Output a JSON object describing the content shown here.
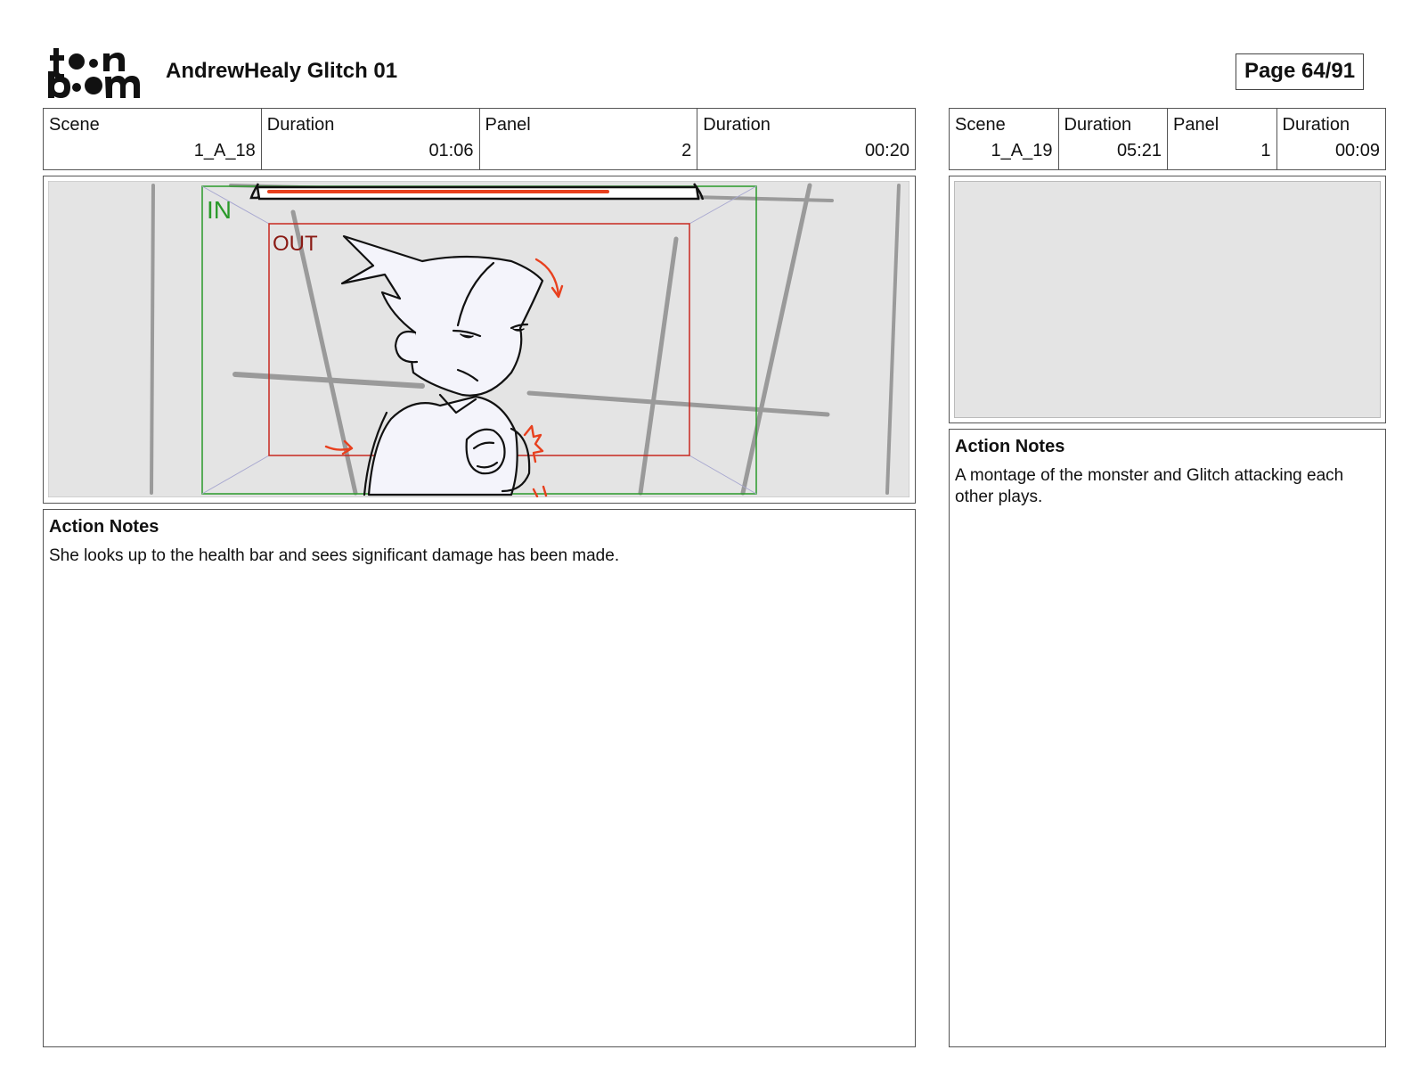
{
  "logo": {
    "word_top": "toon",
    "word_bottom": "boom"
  },
  "document": {
    "title": "AndrewHealy Glitch 01",
    "page": "Page 64/91"
  },
  "left_panel": {
    "scene_label": "Scene",
    "scene_value": "1_A_18",
    "scene_duration_label": "Duration",
    "scene_duration_value": "01:06",
    "panel_label": "Panel",
    "panel_value": "2",
    "panel_duration_label": "Duration",
    "panel_duration_value": "00:20",
    "frame": {
      "in_label": "IN",
      "out_label": "OUT"
    },
    "action_notes_heading": "Action Notes",
    "action_notes_text": "She looks up to the health bar and sees significant damage has been made."
  },
  "right_panel": {
    "scene_label": "Scene",
    "scene_value": "1_A_19",
    "scene_duration_label": "Duration",
    "scene_duration_value": "05:21",
    "panel_label": "Panel",
    "panel_value": "1",
    "panel_duration_label": "Duration",
    "panel_duration_value": "00:09",
    "action_notes_heading": "Action Notes",
    "action_notes_text": "A montage of the monster and Glitch attacking each other plays."
  },
  "colors": {
    "in_frame": "#2a9a2a",
    "out_frame": "#c8281e",
    "health_bar": "#e8401e",
    "canvas": "#e4e4e4"
  }
}
